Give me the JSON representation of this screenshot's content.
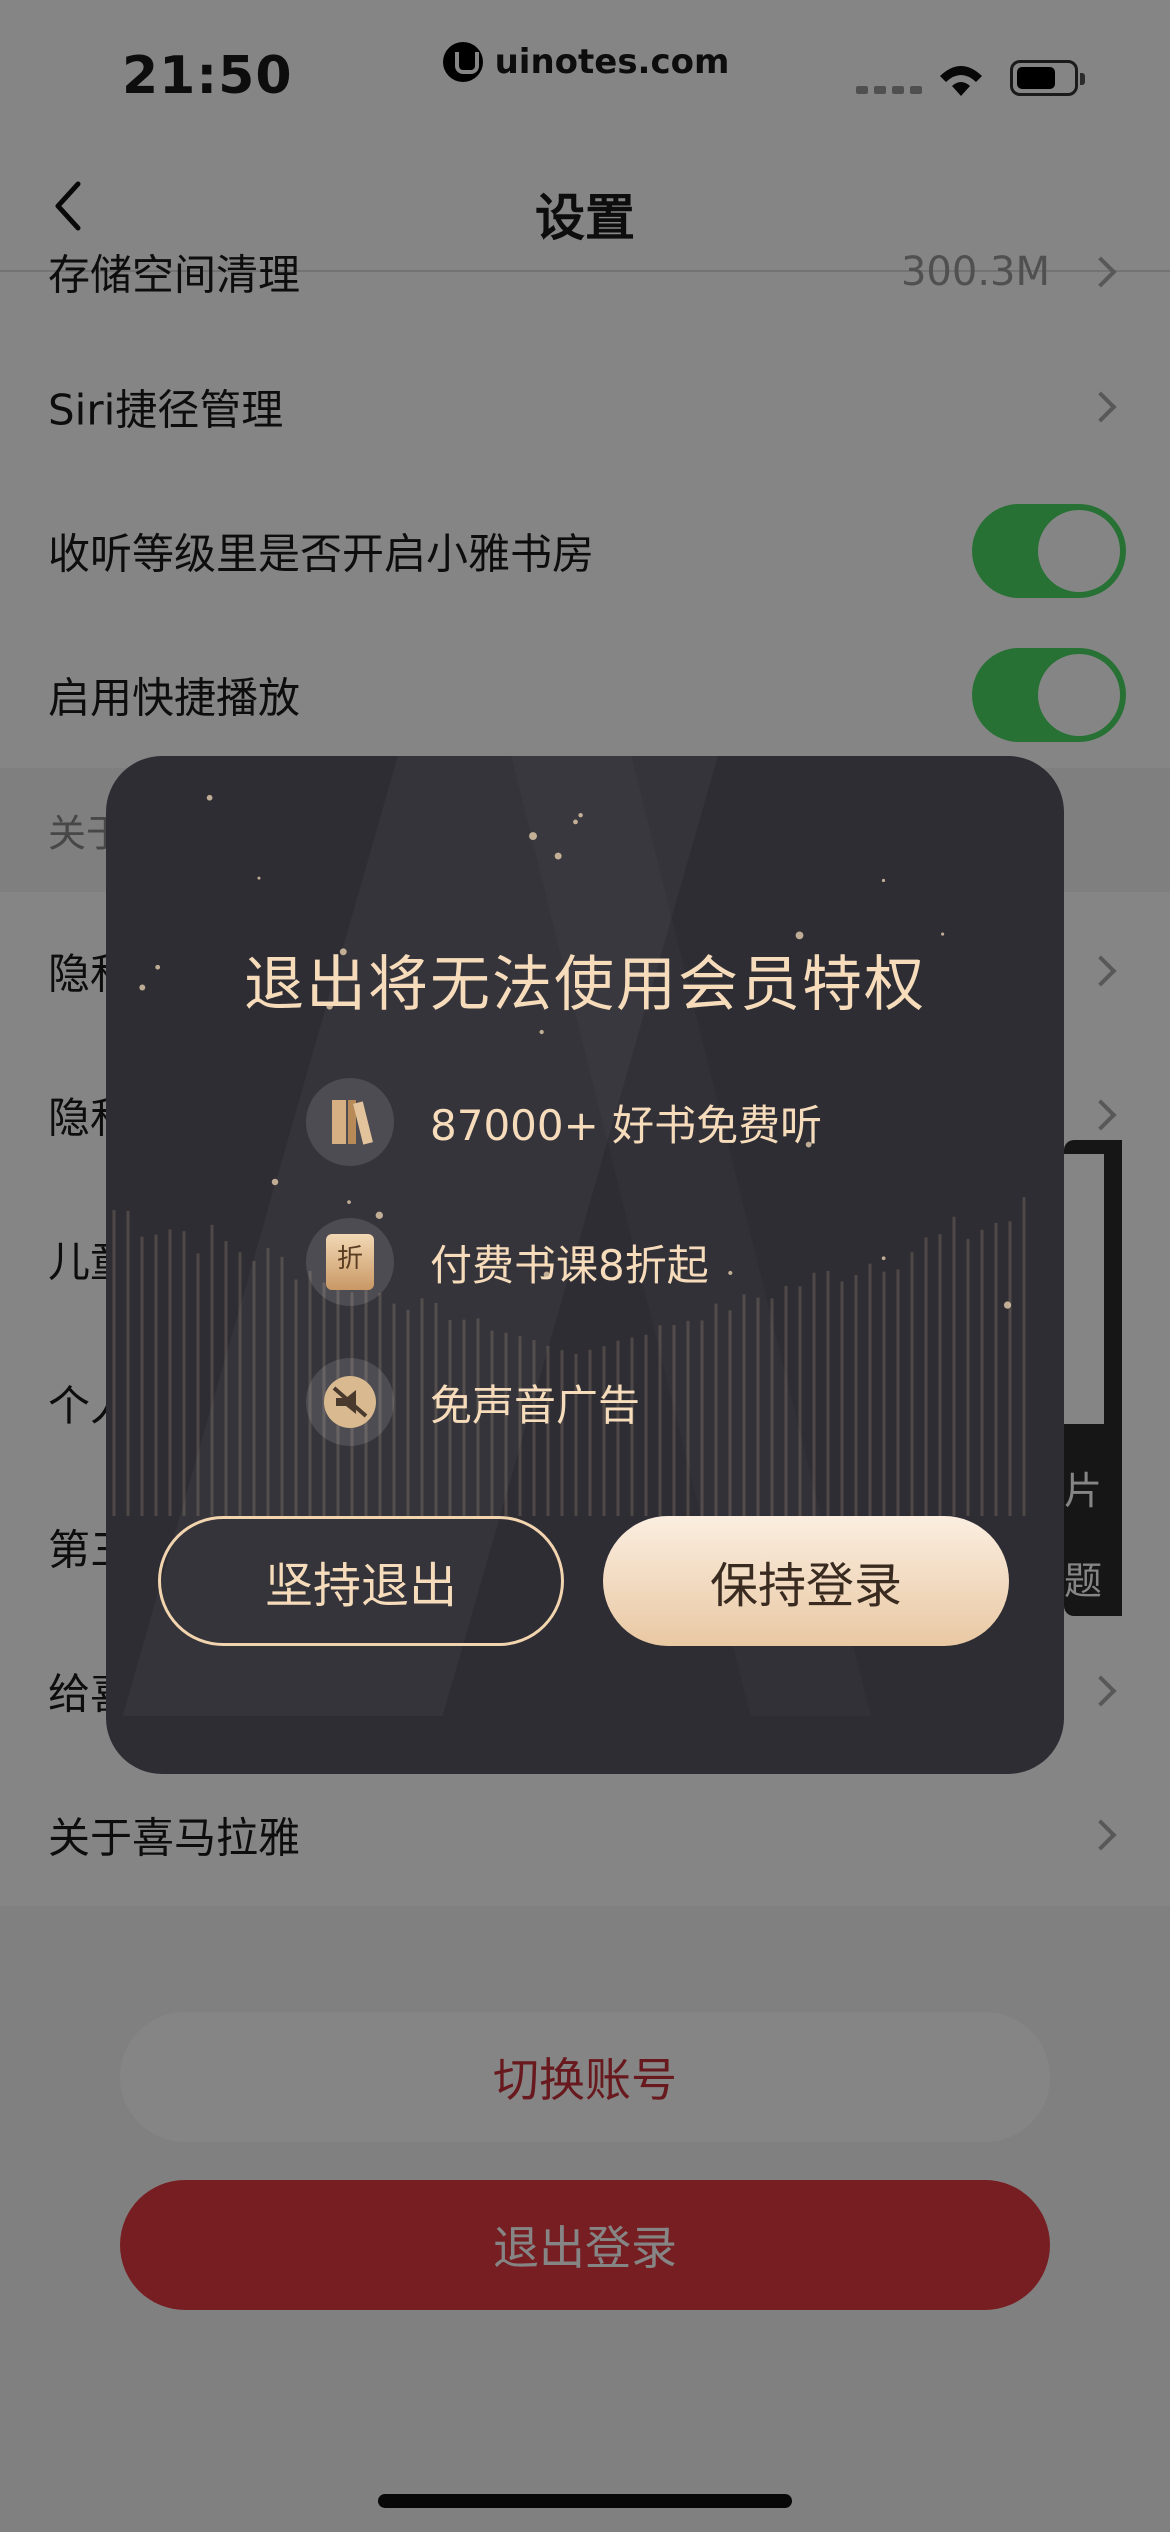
{
  "status_bar": {
    "time": "21:50",
    "watermark": "uinotes.com"
  },
  "nav": {
    "title": "设置"
  },
  "settings": {
    "storage": {
      "label": "存储空间清理",
      "value": "300.3M"
    },
    "siri": {
      "label": "Siri捷径管理"
    },
    "xiaoya": {
      "label": "收听等级里是否开启小雅书房",
      "enabled": true
    },
    "quickplay": {
      "label": "启用快捷播放",
      "enabled": true
    },
    "section_about": "关于",
    "rows": [
      {
        "label": "隐私"
      },
      {
        "label": "隐私"
      },
      {
        "label": "儿童"
      },
      {
        "label": "个人"
      },
      {
        "label": "第三"
      },
      {
        "label": "给喜"
      }
    ],
    "about": {
      "label": "关于喜马拉雅"
    }
  },
  "side_card": {
    "line1": "片",
    "line2": "题"
  },
  "buttons": {
    "switch_account": "切换账号",
    "logout": "退出登录"
  },
  "modal": {
    "title": "退出将无法使用会员特权",
    "benefits": [
      {
        "icon": "book-icon",
        "text": "87000+ 好书免费听"
      },
      {
        "icon": "discount-icon",
        "text": "付费书课8折起"
      },
      {
        "icon": "no-ads-icon",
        "text": "免声音广告"
      }
    ],
    "discount_icon_text": "折",
    "quit_label": "坚持退出",
    "keep_label": "保持登录"
  },
  "colors": {
    "toggle_on": "#4cd964",
    "logout_red": "#e53b41",
    "modal_bg": "#2e2d34",
    "gold_text": "#f6dcbb"
  }
}
